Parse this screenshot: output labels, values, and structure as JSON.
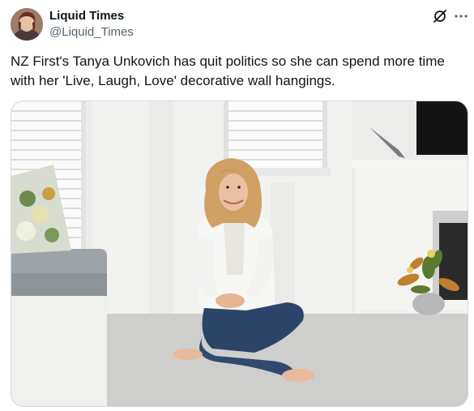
{
  "author": {
    "name": "Liquid Times",
    "handle": "@Liquid_Times"
  },
  "tweet": {
    "text": "NZ First's Tanya Unkovich has quit politics so she can spend more time with her 'Live, Laugh, Love' decorative wall hangings."
  },
  "icons": {
    "grok": "grok-icon",
    "more": "more-options-icon"
  },
  "colors": {
    "text": "#0f1419",
    "secondary": "#536471",
    "border": "#cfd9de"
  }
}
